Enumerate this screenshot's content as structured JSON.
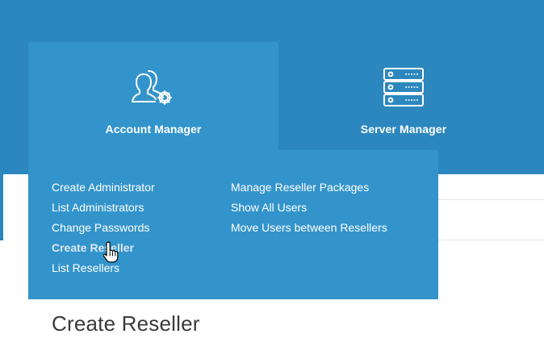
{
  "tabs": [
    {
      "label": "Account Manager",
      "icon": "users-gear-icon"
    },
    {
      "label": "Server Manager",
      "icon": "server-icon"
    }
  ],
  "account_menu": {
    "column1": [
      "Create Administrator",
      "List Administrators",
      "Change Passwords",
      "Create Reseller",
      "List Resellers"
    ],
    "column2": [
      "Manage Reseller Packages",
      "Show All Users",
      "Move Users between Resellers"
    ],
    "active_item": "Create Reseller"
  },
  "page": {
    "title": "Create Reseller"
  },
  "colors": {
    "header": "#2c87be",
    "active_panel": "#3394cb",
    "text": "#ffffff"
  }
}
